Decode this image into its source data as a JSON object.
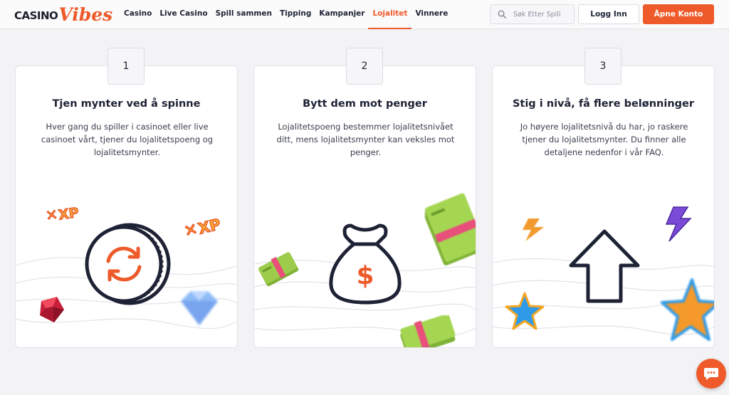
{
  "header": {
    "logo": {
      "part1": "CASINO",
      "part2": "Vibes"
    },
    "nav": [
      {
        "label": "Casino",
        "active": false
      },
      {
        "label": "Live Casino",
        "active": false
      },
      {
        "label": "Spill sammen",
        "active": false
      },
      {
        "label": "Tipping",
        "active": false
      },
      {
        "label": "Kampanjer",
        "active": false
      },
      {
        "label": "Lojalitet",
        "active": true
      },
      {
        "label": "Vinnere",
        "active": false
      }
    ],
    "search": {
      "placeholder": "Søk Etter Spill",
      "icon": "search-icon"
    },
    "login_label": "Logg Inn",
    "register_label": "Åpne Konto"
  },
  "steps": [
    {
      "number": "1",
      "title": "Tjen mynter ved å spinne",
      "description": "Hver gang du spiller i casinoet eller live casinoet vårt, tjener du lojalitetspoeng og lojalitetsmynter.",
      "illustration": "coin-refresh-icon"
    },
    {
      "number": "2",
      "title": "Bytt dem mot penger",
      "description": "Lojalitetspoeng bestemmer lojalitetsnivået ditt, mens lojalitetsmynter kan veksles mot penger.",
      "illustration": "money-bag-icon"
    },
    {
      "number": "3",
      "title": "Stig i nivå, få flere belønninger",
      "description": "Jo høyere lojalitetsnivå du har, jo raskere tjener du lojalitetsmynter. Du finner alle detaljene nedenfor i vår FAQ.",
      "illustration": "arrow-up-icon"
    }
  ],
  "decorations": {
    "xp_text": "XP"
  },
  "chat": {
    "icon": "chat-icon"
  },
  "colors": {
    "accent": "#ee5a2a",
    "text": "#1e2235",
    "background": "#f3f3f6",
    "card": "#ffffff"
  }
}
